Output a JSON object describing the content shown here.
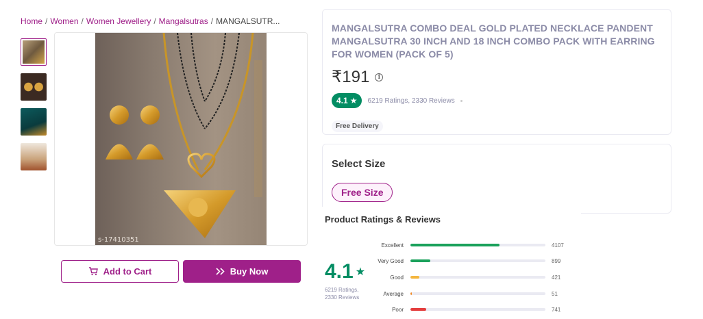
{
  "breadcrumb": {
    "items": [
      "Home",
      "Women",
      "Women Jewellery",
      "Mangalsutras"
    ],
    "current": "MANGALSUTR..."
  },
  "gallery": {
    "thumbnails": [
      "thumb-1",
      "thumb-2",
      "thumb-3",
      "thumb-4"
    ],
    "active_index": 0,
    "watermark": "s-17410351"
  },
  "actions": {
    "add_to_cart": "Add to Cart",
    "buy_now": "Buy Now"
  },
  "product": {
    "title": "MANGALSUTRA COMBO DEAL GOLD PLATED NECKLACE PANDENT MANGALSUTRA 30 INCH AND 18 INCH COMBO PACK WITH EARRING FOR WOMEN (PACK OF 5)",
    "price": "₹191",
    "rating": "4.1",
    "ratings_reviews": "6219 Ratings, 2330 Reviews",
    "delivery": "Free Delivery"
  },
  "size": {
    "title": "Select Size",
    "options": [
      "Free Size"
    ],
    "selected": "Free Size"
  },
  "reviews": {
    "title": "Product Ratings & Reviews",
    "average": "4.1",
    "ratings_line": "6219 Ratings,",
    "reviews_line": "2330 Reviews",
    "breakdown": [
      {
        "label": "Excellent",
        "count": "4107",
        "fraction": 0.66,
        "color": "#1aa15b"
      },
      {
        "label": "Very Good",
        "count": "899",
        "fraction": 0.145,
        "color": "#1aa15b"
      },
      {
        "label": "Good",
        "count": "421",
        "fraction": 0.068,
        "color": "#f4b63f"
      },
      {
        "label": "Average",
        "count": "51",
        "fraction": 0.008,
        "color": "#f08a24"
      },
      {
        "label": "Poor",
        "count": "741",
        "fraction": 0.119,
        "color": "#e43d3d"
      }
    ]
  },
  "colors": {
    "brand": "#9f2089",
    "rating_green": "#038d63"
  }
}
